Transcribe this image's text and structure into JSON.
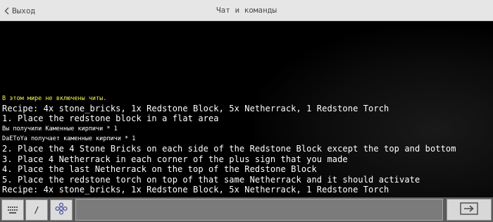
{
  "header": {
    "back_label": "Выход",
    "title": "Чат и команды"
  },
  "chat": {
    "lines": [
      {
        "text": "В этом мире не включены читы.",
        "style": "small yellow"
      },
      {
        "text": "Recipe: 4x stone_bricks, 1x Redstone Block, 5x Netherrack, 1 Redstone Torch",
        "style": "big"
      },
      {
        "text": "1. Place the redstone block in a flat area",
        "style": "big"
      },
      {
        "text": "Вы получили Каменные кирпичи * 1",
        "style": "small"
      },
      {
        "text": "DaEToYa получает каменные кирпичи * 1",
        "style": "small"
      },
      {
        "text": "2. Place the 4 Stone Bricks on each side of the Redstone Block except the top and bottom",
        "style": "big"
      },
      {
        "text": "3. Place 4 Netherrack in each corner of the plus sign that you made",
        "style": "big"
      },
      {
        "text": "4. Place the last Netherrack on the top of the Redstone Block",
        "style": "big"
      },
      {
        "text": "5. Place the redstone torch on top of that same Netherrack and it should activate",
        "style": "big"
      },
      {
        "text": "Recipe: 4x stone_bricks, 1x Redstone Block, 5x Netherrack, 1 Redstone Torch",
        "style": "big"
      }
    ]
  },
  "toolbar": {
    "slash_label": "/",
    "input_value": ""
  },
  "colors": {
    "header_bg": "#e6e6e6",
    "chat_bg": "#000000",
    "chat_text": "#ffffff",
    "system_text": "#f2f256",
    "bottom_bar_bg": "#5a5a5a"
  },
  "icons": {
    "back": "chevron-left-icon",
    "grid": "keyboard-grid-icon",
    "settings": "flower-settings-icon",
    "send": "send-arrow-icon"
  }
}
